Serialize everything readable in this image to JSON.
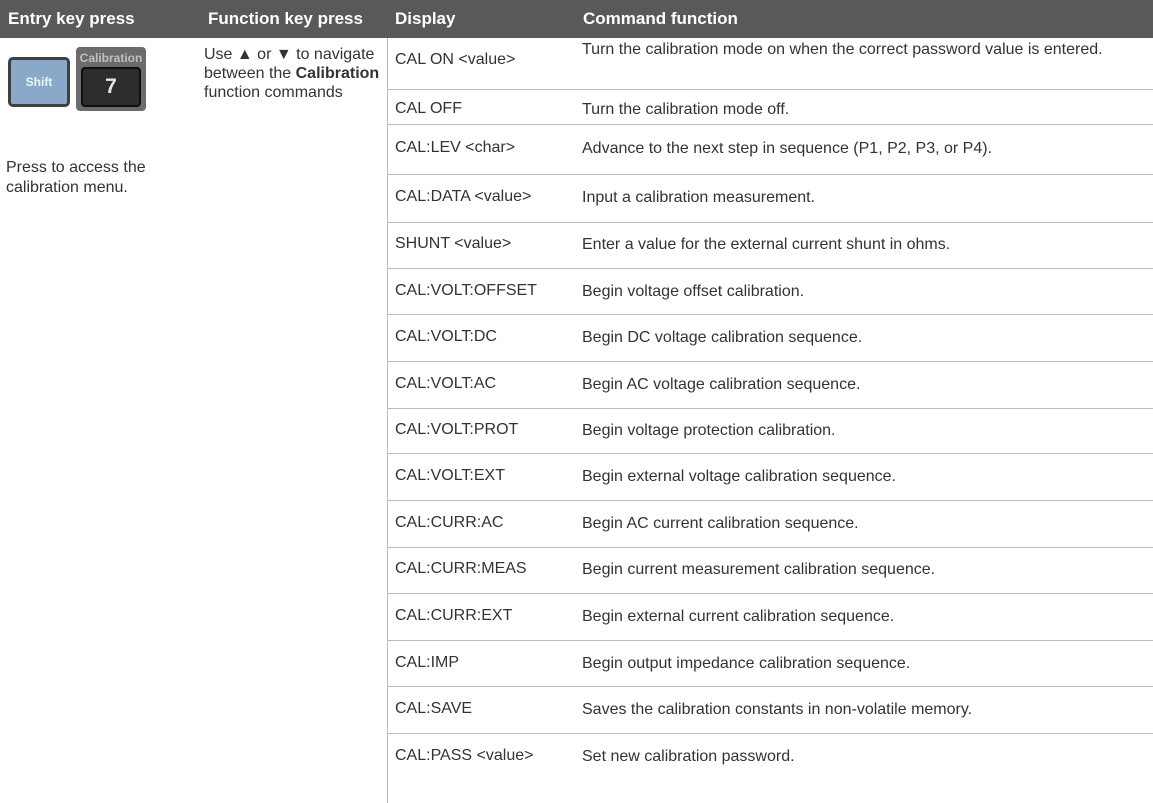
{
  "header": {
    "entry": "Entry key press",
    "function": "Function key press",
    "display": "Display",
    "command": "Command function"
  },
  "keys": {
    "shift_label": "Shift",
    "calibration_caption": "Calibration",
    "seven_label": "7"
  },
  "entry_note": "Press to access the calibration menu.",
  "function_note": {
    "before": "Use ▲ or ▼ to navigate between the ",
    "bold": "Calibration",
    "after": " function commands"
  },
  "rows": [
    {
      "display": "CAL ON <value>",
      "function": "Turn the calibration mode on when the correct password value is entered."
    },
    {
      "display": "CAL OFF",
      "function": "Turn the calibration mode off."
    },
    {
      "display": "CAL:LEV <char>",
      "function": "Advance to the next step in sequence (P1, P2, P3, or P4)."
    },
    {
      "display": "CAL:DATA <value>",
      "function": "Input a calibration measurement."
    },
    {
      "display": "SHUNT <value>",
      "function": "Enter a value for the external current shunt in ohms."
    },
    {
      "display": "CAL:VOLT:OFFSET",
      "function": "Begin voltage offset calibration."
    },
    {
      "display": "CAL:VOLT:DC",
      "function": "Begin DC voltage calibration sequence."
    },
    {
      "display": "CAL:VOLT:AC",
      "function": "Begin AC voltage calibration sequence."
    },
    {
      "display": "CAL:VOLT:PROT",
      "function": "Begin voltage protection calibration."
    },
    {
      "display": "CAL:VOLT:EXT",
      "function": "Begin external voltage calibration sequence."
    },
    {
      "display": "CAL:CURR:AC",
      "function": "Begin AC current calibration sequence."
    },
    {
      "display": "CAL:CURR:MEAS",
      "function": "Begin current measurement calibration sequence."
    },
    {
      "display": "CAL:CURR:EXT",
      "function": "Begin external current calibration sequence."
    },
    {
      "display": "CAL:IMP",
      "function": "Begin output impedance calibration sequence."
    },
    {
      "display": "CAL:SAVE",
      "function": "Saves the calibration constants in non-volatile memory."
    },
    {
      "display": "CAL:PASS <value>",
      "function": "Set new calibration password."
    }
  ]
}
